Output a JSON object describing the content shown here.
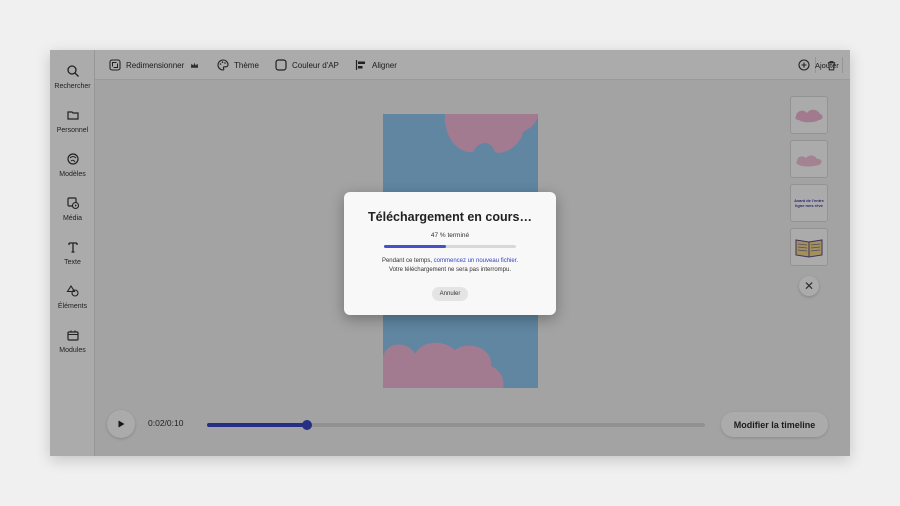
{
  "sidebar": {
    "items": [
      {
        "label": "Rechercher",
        "icon": "search-icon"
      },
      {
        "label": "Personnel",
        "icon": "folder-icon"
      },
      {
        "label": "Modèles",
        "icon": "templates-icon"
      },
      {
        "label": "Média",
        "icon": "media-icon"
      },
      {
        "label": "Texte",
        "icon": "text-icon"
      },
      {
        "label": "Éléments",
        "icon": "shapes-icon"
      },
      {
        "label": "Modules",
        "icon": "modules-icon"
      }
    ]
  },
  "toolbar": {
    "resize_label": "Redimensionner",
    "theme_label": "Thème",
    "bg_color_label": "Couleur d'AP",
    "align_label": "Aligner",
    "add_label": "Ajouter"
  },
  "thumbnails": {
    "text_thumb_label": "Avant de l'entre ligne mes rêve"
  },
  "timeline": {
    "time": "0:02/0:10",
    "progress": 0.2,
    "edit_button": "Modifier la timeline"
  },
  "dialog": {
    "title": "Téléchargement en cours…",
    "percent_text": "47 % terminé",
    "progress": 0.47,
    "message_prefix": "Pendant ce temps, ",
    "message_link": "commencez un nouveau fichier.",
    "message_line2": "Votre téléchargement ne sera pas interrompu.",
    "cancel_label": "Annuler"
  },
  "colors": {
    "accent": "#3b45c8",
    "artboard_blue": "#8fc8f2",
    "artboard_pink": "#f2b8d8"
  }
}
